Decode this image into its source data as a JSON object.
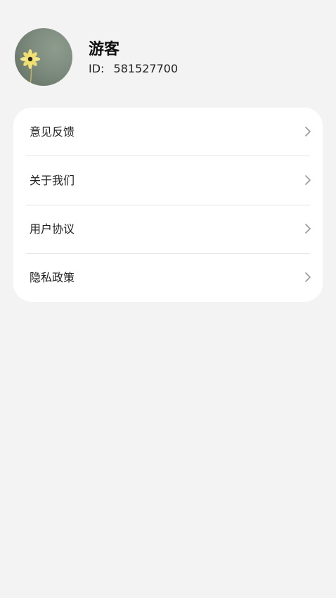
{
  "profile": {
    "name": "游客",
    "id_label": "ID:",
    "id_value": "581527700"
  },
  "menu": {
    "items": [
      {
        "label": "意见反馈",
        "icon": "chevron-right-icon"
      },
      {
        "label": "关于我们",
        "icon": "chevron-right-icon"
      },
      {
        "label": "用户协议",
        "icon": "chevron-right-icon"
      },
      {
        "label": "隐私政策",
        "icon": "chevron-right-icon"
      }
    ]
  },
  "colors": {
    "background": "#f3f3f3",
    "card": "#ffffff",
    "divider": "#e6e6e6",
    "chevron": "#9a9a9a"
  }
}
